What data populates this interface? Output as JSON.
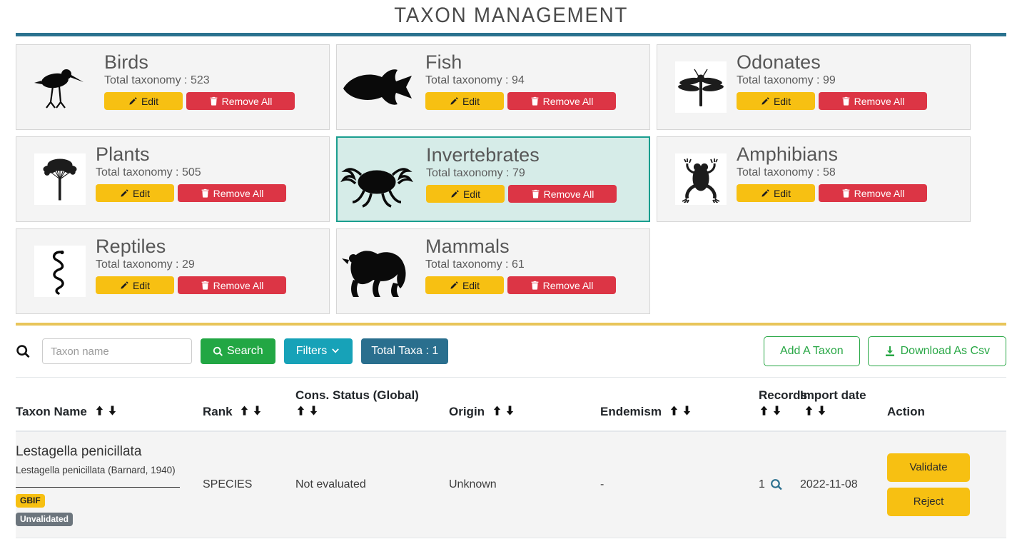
{
  "header": {
    "title": "TAXON MANAGEMENT",
    "rule_color": "#2a728f"
  },
  "theme": {
    "accent_teal": "#2a728f",
    "selected_card_bg": "#d6ece8",
    "selected_card_border": "#1a9e8f",
    "yellow": "#f7c012",
    "red": "#dc3545",
    "green": "#22a744",
    "cyan": "#17a2b8",
    "gold_divider": "#e8c55a",
    "row_bg": "#f4f4f4"
  },
  "group_cards": {
    "count_label_prefix": "Total taxonomy : ",
    "edit_label": "Edit",
    "remove_label": "Remove All",
    "items": [
      {
        "name": "Birds",
        "count": "523",
        "total_text": "Total taxonomy : 523",
        "icon": "bird-icon",
        "selected": false,
        "thumb_style": "plain"
      },
      {
        "name": "Fish",
        "count": "94",
        "total_text": "Total taxonomy : 94",
        "icon": "fish-icon",
        "selected": false,
        "thumb_style": "wide"
      },
      {
        "name": "Odonates",
        "count": "99",
        "total_text": "Total taxonomy : 99",
        "icon": "dragonfly-icon",
        "selected": false,
        "thumb_style": "boxed"
      },
      {
        "name": "Plants",
        "count": "505",
        "total_text": "Total taxonomy : 505",
        "icon": "tree-icon",
        "selected": false,
        "thumb_style": "boxed"
      },
      {
        "name": "Invertebrates",
        "count": "79",
        "total_text": "Total taxonomy : 79",
        "icon": "crab-icon",
        "selected": true,
        "thumb_style": "wide"
      },
      {
        "name": "Amphibians",
        "count": "58",
        "total_text": "Total taxonomy : 58",
        "icon": "frog-icon",
        "selected": false,
        "thumb_style": "boxed"
      },
      {
        "name": "Reptiles",
        "count": "29",
        "total_text": "Total taxonomy : 29",
        "icon": "snake-icon",
        "selected": false,
        "thumb_style": "boxed"
      },
      {
        "name": "Mammals",
        "count": "61",
        "total_text": "Total taxonomy : 61",
        "icon": "gorilla-icon",
        "selected": false,
        "thumb_style": "wide"
      }
    ]
  },
  "toolbar": {
    "search_icon": "search-icon",
    "search_placeholder": "Taxon name",
    "search_value": "",
    "search_label": "Search",
    "filters_label": "Filters",
    "filters_chevron": "chevron-down-icon",
    "total_taxa_label": "Total Taxa : 1",
    "add_taxon_label": "Add A Taxon",
    "download_label": "Download As Csv",
    "download_icon": "download-icon"
  },
  "table": {
    "columns": [
      {
        "label": "Taxon Name",
        "sortable": true
      },
      {
        "label": "Rank",
        "sortable": true
      },
      {
        "label": "Cons. Status (Global)",
        "sortable": true
      },
      {
        "label": "Origin",
        "sortable": true
      },
      {
        "label": "Endemism",
        "sortable": true
      },
      {
        "label": "Records",
        "sortable": true
      },
      {
        "label": "Import date",
        "sortable": true
      },
      {
        "label": "Action",
        "sortable": false
      }
    ],
    "rows": [
      {
        "taxon_name": "Lestagella penicillata",
        "authority": "Lestagella penicillata (Barnard, 1940)",
        "source_tag": "GBIF",
        "status_tag": "Unvalidated",
        "rank": "SPECIES",
        "cons_status": "Not evaluated",
        "origin": "Unknown",
        "endemism": "-",
        "records": "1",
        "records_icon": "search-icon",
        "import_date": "2022-11-08",
        "actions": [
          {
            "label": "Validate",
            "name": "validate-button"
          },
          {
            "label": "Reject",
            "name": "reject-button"
          }
        ]
      }
    ]
  }
}
